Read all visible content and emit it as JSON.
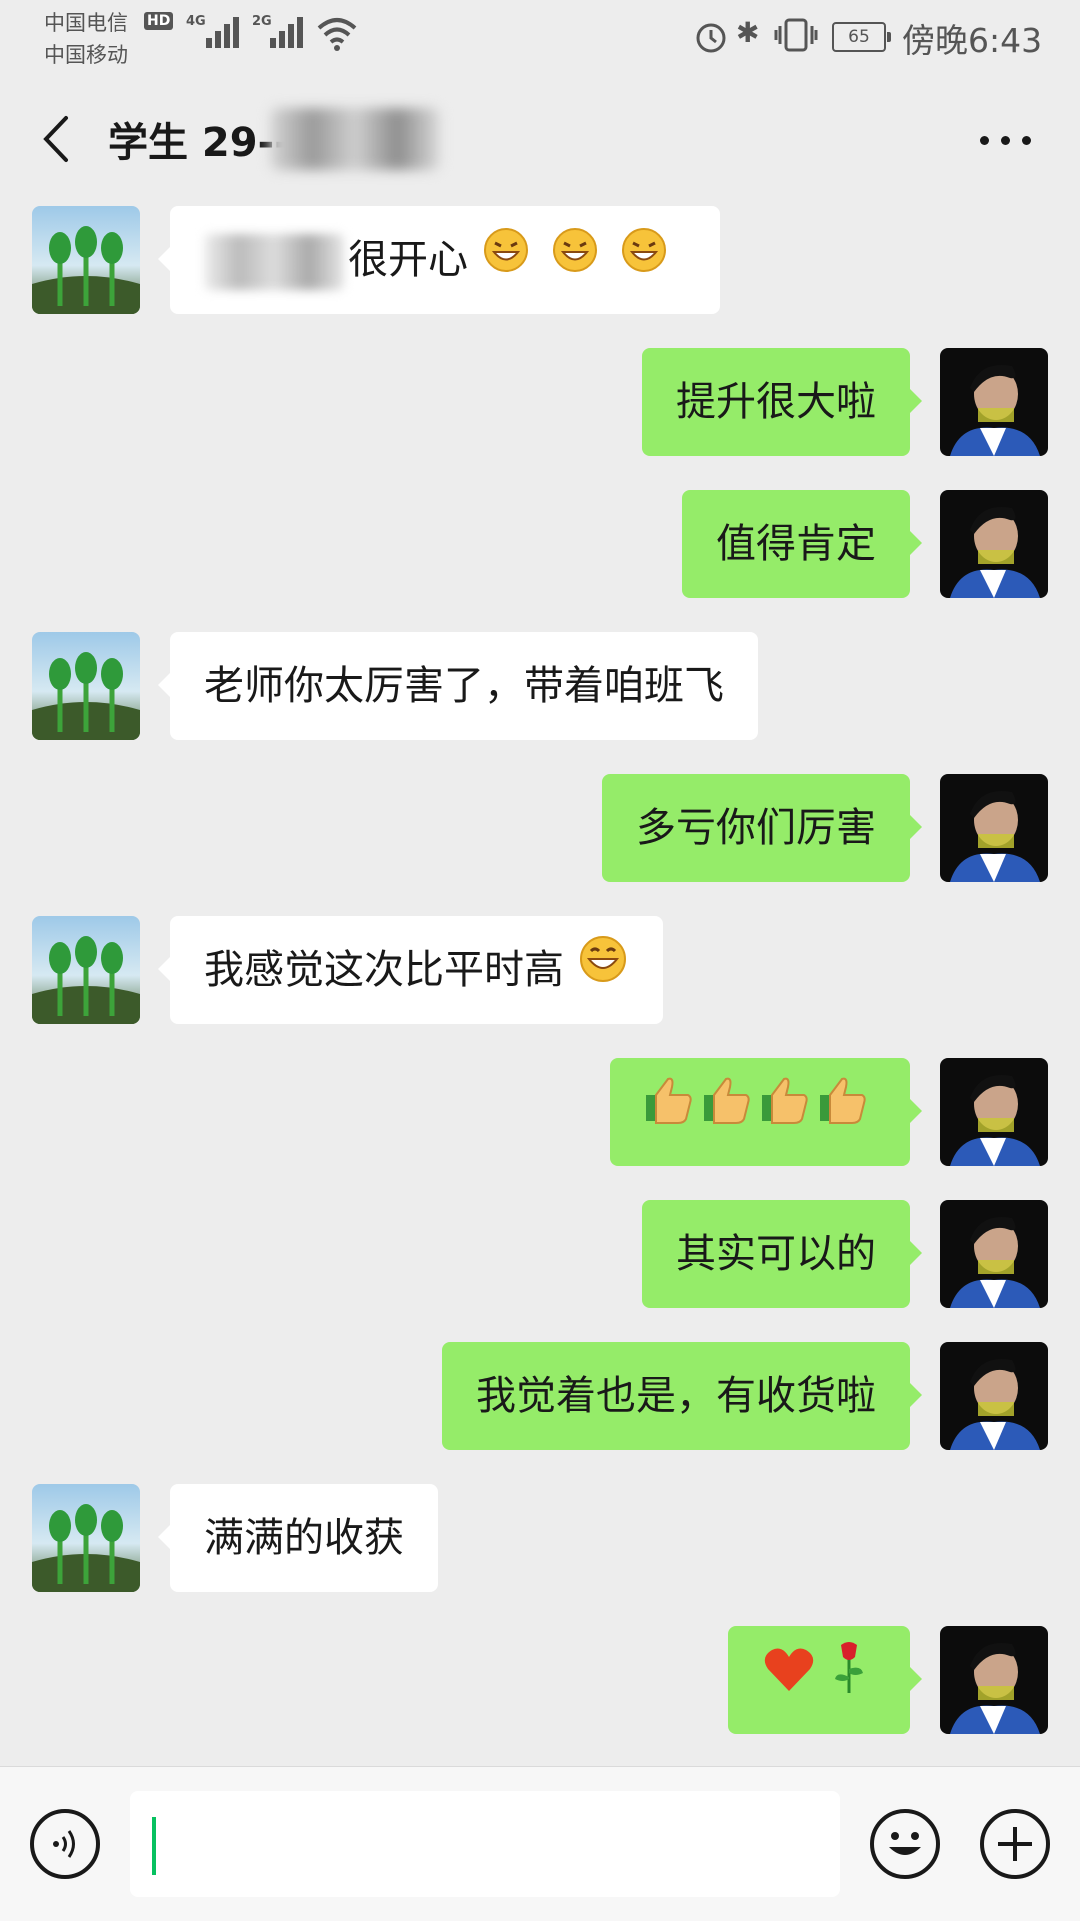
{
  "status_bar": {
    "carrier_1": "中国电信",
    "carrier_2": "中国移动",
    "hd_label": "HD",
    "net_1": "4G",
    "net_2": "2G",
    "battery": "65",
    "time": "傍晚6:43"
  },
  "header": {
    "title": "学生 29--"
  },
  "messages": [
    {
      "side": "in",
      "text": "很开心"
    },
    {
      "side": "out",
      "text": "提升很大啦"
    },
    {
      "side": "out",
      "text": "值得肯定"
    },
    {
      "side": "in",
      "text": "老师你太厉害了，带着咱班飞"
    },
    {
      "side": "out",
      "text": "多亏你们厉害"
    },
    {
      "side": "in",
      "text": "我感觉这次比平时高"
    },
    {
      "side": "out",
      "text": "thumbs-up ×4"
    },
    {
      "side": "out",
      "text": "其实可以的"
    },
    {
      "side": "out",
      "text": "我觉着也是，有收货啦"
    },
    {
      "side": "in",
      "text": "满满的收获"
    },
    {
      "side": "out",
      "text": "heart + rose"
    }
  ],
  "colors": {
    "background": "#ededed",
    "outgoing_bubble": "#95ec69",
    "incoming_bubble": "#ffffff",
    "cursor": "#07c160"
  },
  "icons": [
    "back-arrow-icon",
    "more-icon",
    "voice-icon",
    "emoji-icon",
    "plus-icon",
    "grin-emoji-icon",
    "thumbs-up-icon",
    "heart-icon",
    "rose-icon"
  ]
}
